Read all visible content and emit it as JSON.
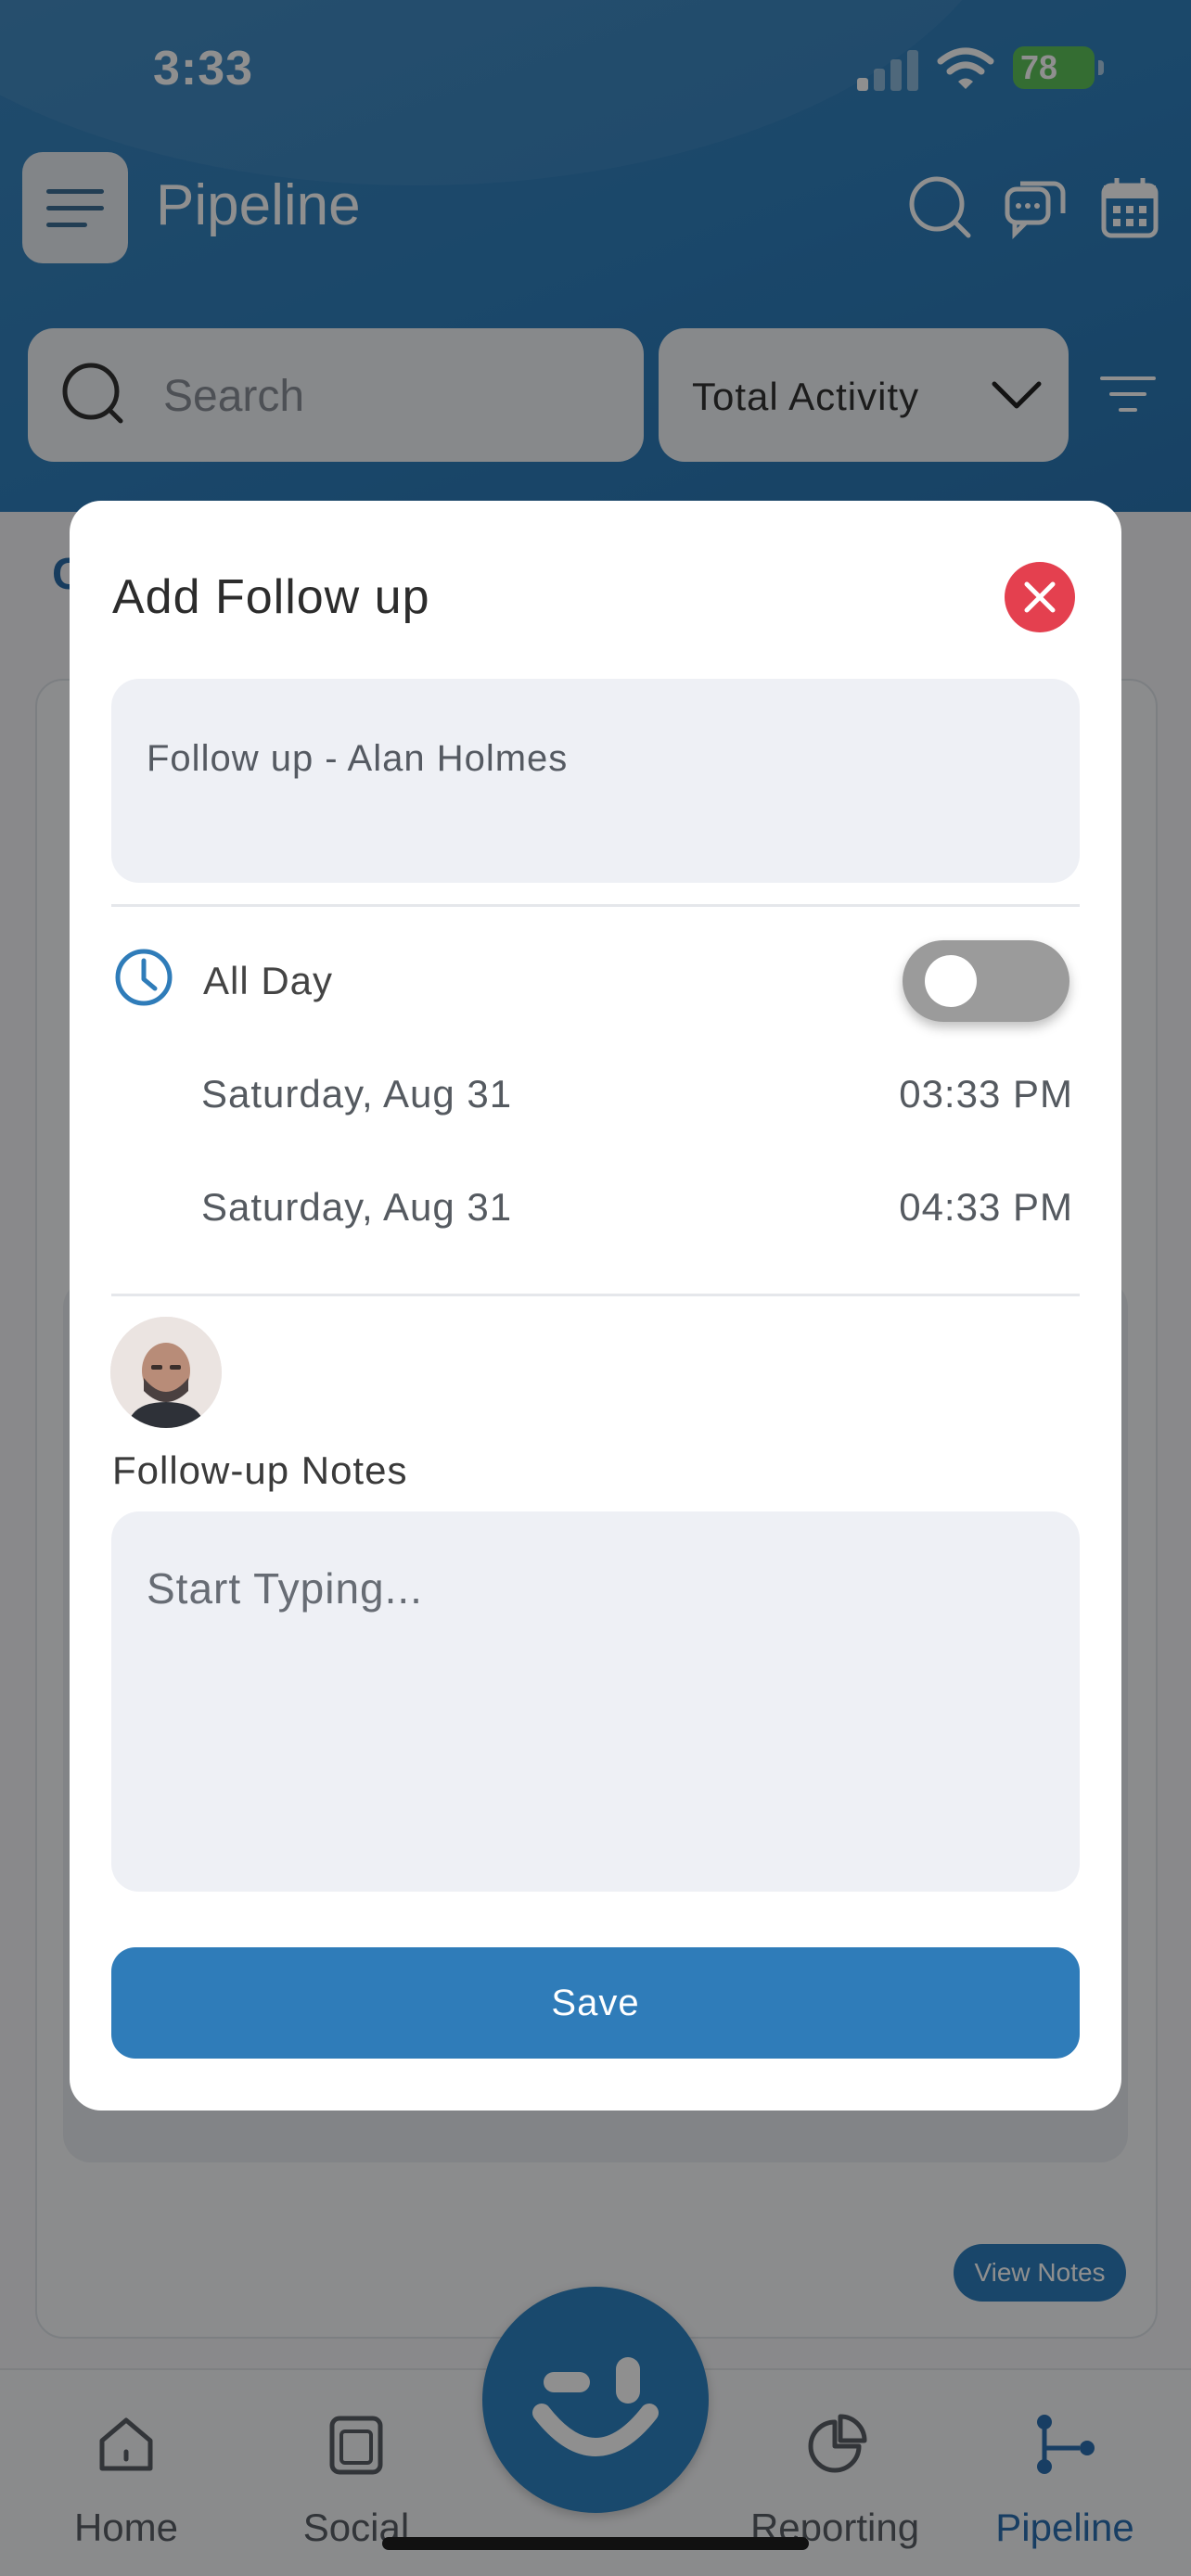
{
  "status_bar": {
    "time": "3:33",
    "battery": "78"
  },
  "header": {
    "title": "Pipeline"
  },
  "search": {
    "placeholder": "Search"
  },
  "activity_filter": {
    "selected": "Total Activity"
  },
  "view_notes_label": "View Notes",
  "tabs": [
    {
      "label": "Home",
      "icon": "home-icon"
    },
    {
      "label": "Social",
      "icon": "social-icon"
    },
    {
      "label": "",
      "icon": "assistant-icon"
    },
    {
      "label": "Reporting",
      "icon": "pie-chart-icon"
    },
    {
      "label": "Pipeline",
      "icon": "pipeline-icon",
      "active": true
    }
  ],
  "modal": {
    "title": "Add Follow up",
    "follow_up_title": "Follow up - Alan Holmes",
    "all_day_label": "All Day",
    "all_day_enabled": false,
    "start": {
      "date": "Saturday, Aug 31",
      "time": "03:33 PM"
    },
    "end": {
      "date": "Saturday, Aug 31",
      "time": "04:33 PM"
    },
    "notes_label": "Follow-up Notes",
    "notes_placeholder": "Start Typing...",
    "save_label": "Save"
  },
  "colors": {
    "header_bg": "#2f7fbd",
    "accent": "#2f7cb9",
    "close": "#e4404f",
    "battery": "#5dc25a"
  }
}
